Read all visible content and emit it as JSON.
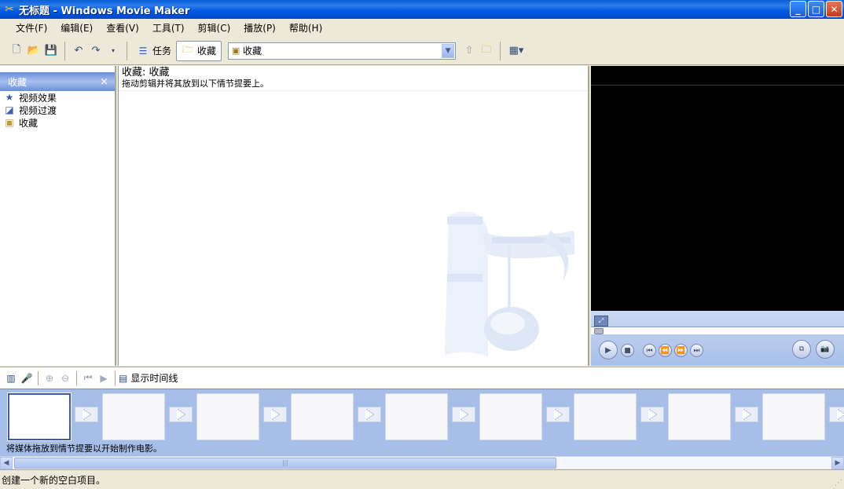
{
  "window": {
    "title": "无标题 - Windows Movie Maker",
    "controls": {
      "minimize": "_",
      "maximize": "□",
      "close": "✕"
    }
  },
  "menu": [
    "文件(F)",
    "编辑(E)",
    "查看(V)",
    "工具(T)",
    "剪辑(C)",
    "播放(P)",
    "帮助(H)"
  ],
  "toolbar": {
    "tasks_label": "任务",
    "collections_label": "收藏",
    "location_value": "收藏"
  },
  "left_pane": {
    "header": "收藏",
    "close": "×",
    "items": [
      {
        "label": "视频效果",
        "icon": "star-icon"
      },
      {
        "label": "视频过渡",
        "icon": "transition-icon"
      },
      {
        "label": "收藏",
        "icon": "collection-icon"
      }
    ]
  },
  "content": {
    "title": "收藏: 收藏",
    "subtitle": "拖动剪辑并将其放到以下情节提要上。"
  },
  "storyboard": {
    "show_timeline_label": "显示时间线",
    "hint": "将媒体拖放到情节提要以开始制作电影。",
    "frame_count": 9
  },
  "status": {
    "text": "创建一个新的空白项目。"
  },
  "colors": {
    "titlebar": "#0058E6",
    "storyboard_bg": "#A7BEE9",
    "monitor_bg": "#000000"
  }
}
